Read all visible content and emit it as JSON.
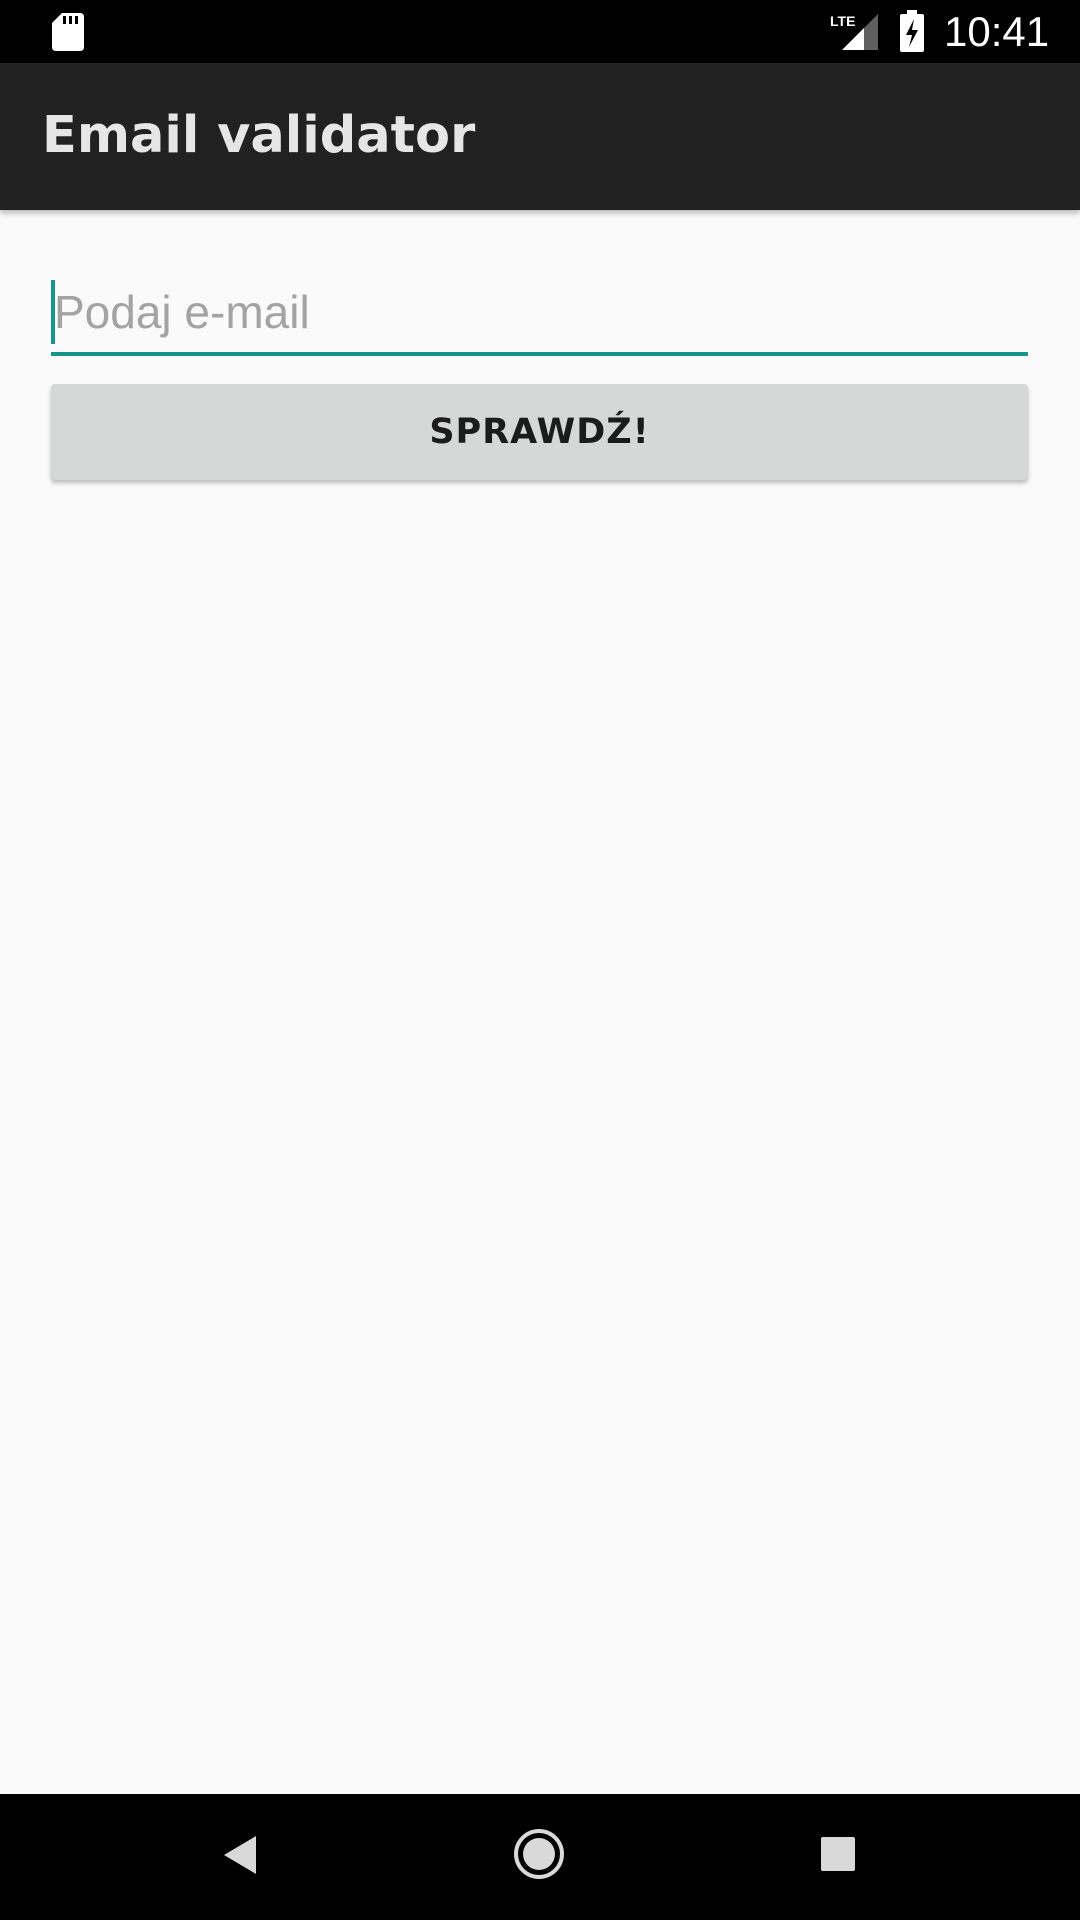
{
  "status_bar": {
    "time": "10:41",
    "network": "LTE",
    "icons": [
      "sd-card-icon",
      "lte-signal-icon",
      "battery-charging-icon"
    ]
  },
  "app_bar": {
    "title": "Email validator"
  },
  "form": {
    "email_placeholder": "Podaj e-mail",
    "email_value": "",
    "check_button_label": "SPRAWDŹ!"
  },
  "nav_bar": {
    "icons": [
      "back-icon",
      "home-icon",
      "recents-icon"
    ]
  },
  "colors": {
    "accent": "#159688",
    "app_bar": "#212121",
    "background": "#fafafa",
    "button": "#d6d7d7"
  }
}
